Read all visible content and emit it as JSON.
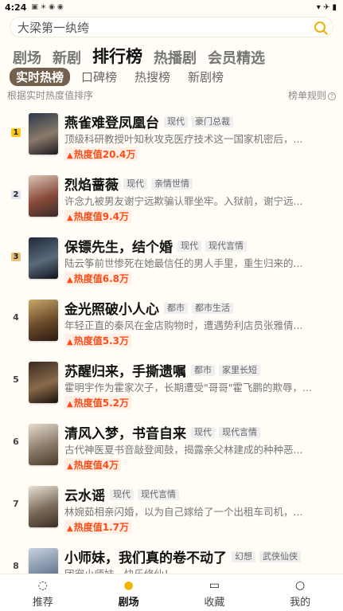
{
  "status_bar": {
    "time": "4:24",
    "apps": "▣ ∗ ◉ ◉",
    "right": "▾ ✈ ▮"
  },
  "search": {
    "text": "大梁第一纨绔"
  },
  "nav_tabs": [
    "剧场",
    "新剧",
    "排行榜",
    "热播剧",
    "会员精选"
  ],
  "sub_tabs": [
    "实时热榜",
    "口碑榜",
    "热搜榜",
    "新剧榜"
  ],
  "info": {
    "left": "根据实时热度值排序",
    "right": "榜单规则"
  },
  "heat_prefix": "热度值",
  "items": [
    {
      "rank": "1",
      "title": "燕雀难登凤凰台",
      "tags": [
        "现代",
        "豪门总裁"
      ],
      "desc": "顶级科研教授叶知秋攻克医疗技术这一国家机密后，...",
      "heat": "20.4万"
    },
    {
      "rank": "2",
      "title": "烈焰蔷薇",
      "tags": [
        "现代",
        "亲情世情"
      ],
      "desc": "许念九被男友谢宁远欺骗认罪坐牢。入狱前，谢宁远...",
      "heat": "9.4万"
    },
    {
      "rank": "3",
      "title": "保镖先生，结个婚",
      "tags": [
        "现代",
        "现代言情"
      ],
      "desc": "陆云筝前世惨死在她最信任的男人手里，重生归来的...",
      "heat": "6.8万"
    },
    {
      "rank": "4",
      "title": "金光照破小人心",
      "tags": [
        "都市",
        "都市生活"
      ],
      "desc": "年轻正直的秦风在金店购物时，遭遇势利店员张雅倩...",
      "heat": "5.3万"
    },
    {
      "rank": "5",
      "title": "苏醒归来，手撕遗嘱",
      "tags": [
        "都市",
        "家里长短"
      ],
      "desc": "霍明宇作为霍家次子，长期遭受\"哥哥\"霍飞鹏的欺辱，...",
      "heat": "5.2万"
    },
    {
      "rank": "6",
      "title": "清风入梦，书音自来",
      "tags": [
        "现代",
        "现代言情"
      ],
      "desc": "古代神医夏书音敲登闻鼓，揭露亲父林建成的种种恶...",
      "heat": "4万"
    },
    {
      "rank": "7",
      "title": "云水谣",
      "tags": [
        "现代",
        "现代言情"
      ],
      "desc": "林婉茹相亲闪婚，以为自己嫁给了一个出租车司机，...",
      "heat": "1.7万"
    },
    {
      "rank": "8",
      "title": "小师妹，我们真的卷不动了",
      "tags": [
        "幻想",
        "武侠仙侠"
      ],
      "desc": "团宠小师妹，快乐修仙！",
      "heat": ""
    }
  ],
  "bottom_nav": [
    "推荐",
    "剧场",
    "收藏",
    "我的"
  ]
}
